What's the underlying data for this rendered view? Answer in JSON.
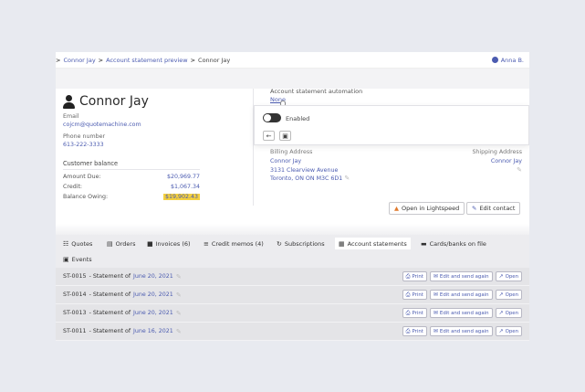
{
  "breadcrumb": {
    "items": [
      "Connor Jay",
      "Account statement preview",
      "Connor Jay"
    ],
    "sep": ">"
  },
  "user": {
    "name": "Anna B."
  },
  "customer": {
    "name": "Connor Jay",
    "email_label": "Email",
    "email": "cojcm@quotemachine.com",
    "phone_label": "Phone number",
    "phone": "613-222-3333",
    "balance_title": "Customer balance",
    "balance": [
      {
        "label": "Amount Due:",
        "value": "$20,969.77"
      },
      {
        "label": "Credit:",
        "value": "$1,067.34"
      },
      {
        "label": "Balance Owing:",
        "value": "$19,902.43"
      }
    ]
  },
  "automation": {
    "title": "Account statement automation",
    "value": "None",
    "toggle_label": "Enabled",
    "toggle_on": false,
    "back_symbol": "←",
    "save_symbol": "▣"
  },
  "billing": {
    "label": "Billing Address",
    "name": "Connor Jay",
    "line1": "3131 Clearview Avenue",
    "line2": "Toronto, ON ON M3C 6D1"
  },
  "shipping": {
    "label": "Shipping Address",
    "name": "Connor Jay"
  },
  "actions": {
    "lightspeed": "Open in Lightspeed",
    "edit_contact": "Edit contact"
  },
  "tabs": [
    {
      "label": "Quotes",
      "icon": "☷"
    },
    {
      "label": "Orders",
      "icon": "▤"
    },
    {
      "label": "Invoices (6)",
      "icon": "■"
    },
    {
      "label": "Credit memos (4)",
      "icon": "≡"
    },
    {
      "label": "Subscriptions",
      "icon": "↻"
    },
    {
      "label": "Account statements",
      "icon": "▦"
    },
    {
      "label": "Cards/banks on file",
      "icon": "▬"
    },
    {
      "label": "Events",
      "icon": "▣"
    }
  ],
  "statements": [
    {
      "id": "ST-0015",
      "date": "June 20, 2021"
    },
    {
      "id": "ST-0014",
      "date": "June 20, 2021"
    },
    {
      "id": "ST-0013",
      "date": "June 20, 2021"
    },
    {
      "id": "ST-0011",
      "date": "June 16, 2021"
    }
  ],
  "statement_label": "- Statement of",
  "row_buttons": {
    "print": "Print",
    "edit_send": "Edit and send again",
    "open": "Open"
  },
  "colors": {
    "accent": "#4b5bb0",
    "highlight": "#f4d03f"
  }
}
